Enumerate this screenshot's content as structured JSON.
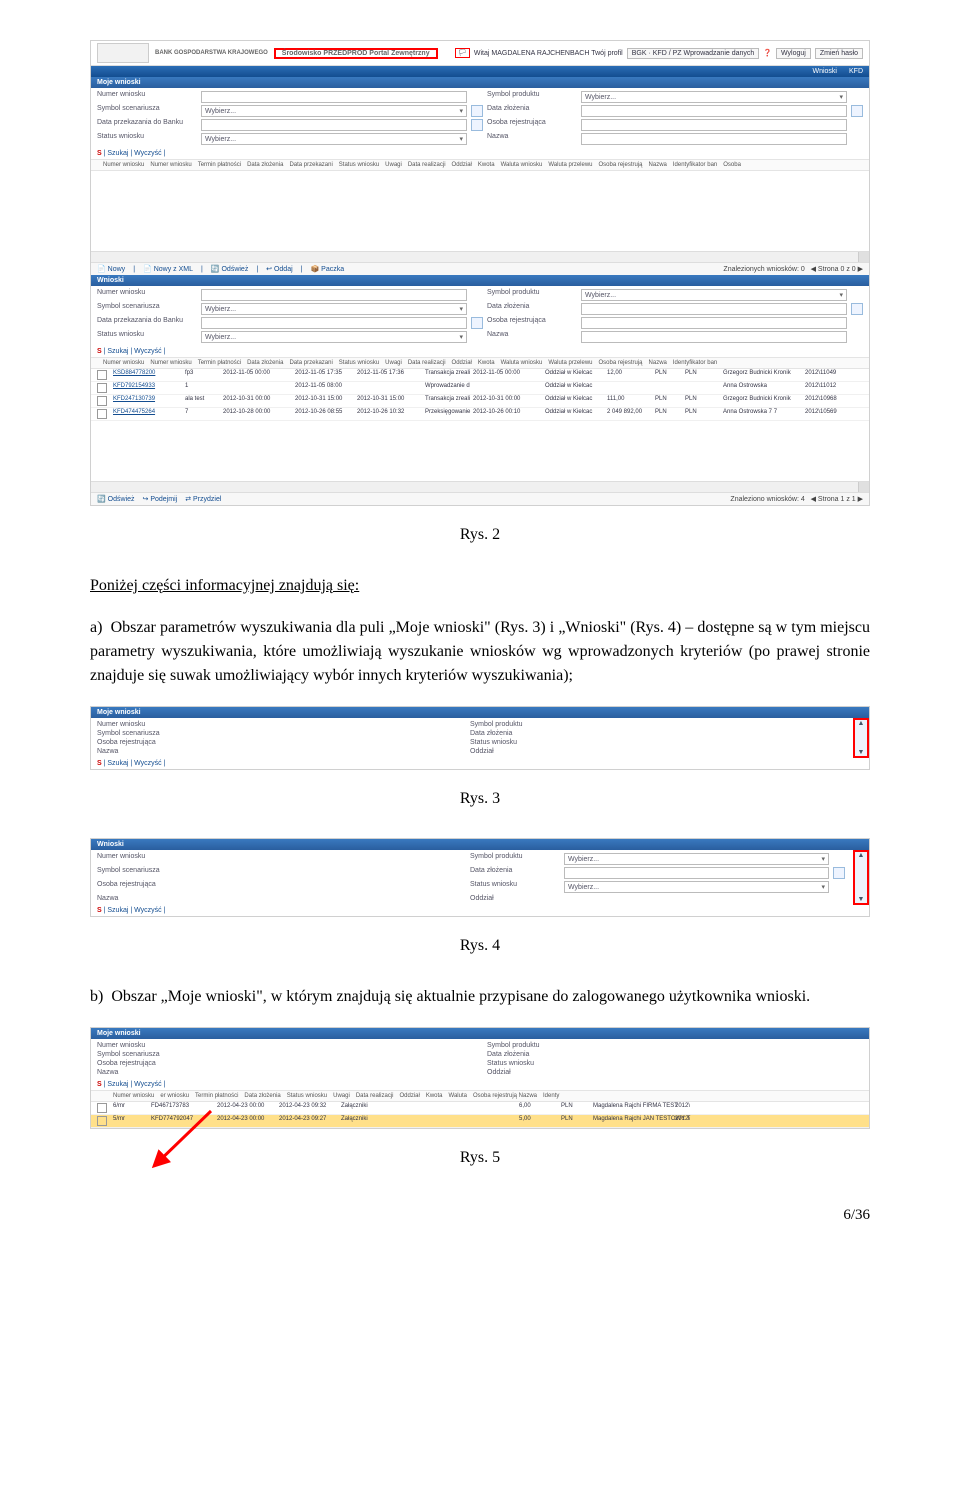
{
  "captions": {
    "r2": "Rys. 2",
    "r3": "Rys. 3",
    "r4": "Rys. 4",
    "r5": "Rys. 5"
  },
  "prose": {
    "intro": "Poniżej części informacyjnej znajdują się:",
    "a_lead": "a)",
    "a_body": "Obszar parametrów wyszukiwania dla puli „Moje wnioski\" (Rys. 3) i „Wnioski\" (Rys. 4) – dostępne są w tym miejscu parametry wyszukiwania, które umożliwiają wyszukanie wniosków wg wprowadzonych kryteriów (po prawej stronie znajduje się suwak umożliwiający wybór innych kryteriów wyszukiwania);",
    "b_lead": "b)",
    "b_body": "Obszar „Moje wnioski\", w którym znajdują się aktualnie przypisane do zalogowanego użytkownika wnioski."
  },
  "header": {
    "bank": "BANK GOSPODARSTWA KRAJOWEGO",
    "env": "Środowisko PRZEDPROD Portal Zewnętrzny",
    "welcome": "Witaj MAGDALENA RAJCHENBACH Twój profil",
    "profile": "BGK · KFD / PZ Wprowadzanie danych",
    "logout": "Wyloguj",
    "changepw": "Zmień hasło",
    "nav": {
      "wnioski": "Wnioski",
      "kfd": "KFD"
    }
  },
  "panel": {
    "moje": "Moje wnioski",
    "wnioski": "Wnioski",
    "labels": {
      "numer": "Numer wniosku",
      "symscen": "Symbol scenariusza",
      "dataprzek": "Data przekazania do Banku",
      "status": "Status wniosku",
      "symprod": "Symbol produktu",
      "datazloz": "Data złożenia",
      "osobarej": "Osoba rejestrująca",
      "nazwa": "Nazwa",
      "oddzial": "Oddział"
    },
    "wybierz": "Wybierz..."
  },
  "search": {
    "s": "S",
    "szukaj": "Szukaj",
    "wyczysc": "Wyczyść"
  },
  "cols": [
    "Numer wniosku",
    "Numer wniosku",
    "Termin płatności",
    "Data złożenia",
    "Data przekazani",
    "Status wniosku",
    "Uwagi",
    "Data realizacji",
    "Oddział",
    "Kwota",
    "Waluta wniosku",
    "Waluta przelewu",
    "Osoba rejestrują",
    "Nazwa",
    "Identyfikator ban",
    "Osoba"
  ],
  "toolbar": {
    "nowy": "Nowy",
    "nowyxml": "Nowy z XML",
    "odswiez": "Odśwież",
    "oddaj": "Oddaj",
    "paczka": "Paczka",
    "podejmij": "Podejmij",
    "przydziel": "Przydziel"
  },
  "footer1": {
    "found": "Znalezionych wniosków: 0",
    "pag": "Strona 0 z 0"
  },
  "footer2": {
    "found": "Znaleziono wniosków: 4",
    "pag": "Strona 1 z 1"
  },
  "rows": [
    {
      "nr": "KSD884778200",
      "nm": "fp3",
      "tp": "2012-11-05 00:00",
      "dz": "2012-11-05 17:35",
      "dp": "2012-11-05 17:36",
      "st": "Transakcja zreali",
      "dr": "2012-11-05 00:00",
      "od": "Oddział w Kielcac",
      "kw": "12,00",
      "ww": "PLN",
      "wp": "PLN",
      "os": "Grzegorz Budnicki Kronik",
      "id": "2012\\11049"
    },
    {
      "nr": "KFD792154933",
      "nm": "1",
      "tp": "",
      "dz": "2012-11-05 08:00",
      "dp": "",
      "st": "Wprowadzanie d",
      "dr": "",
      "od": "Oddział w Kielcac",
      "kw": "",
      "ww": "",
      "wp": "",
      "os": "Anna Ostrowska",
      "id": "2012\\11012"
    },
    {
      "nr": "KFD247130739",
      "nm": "ala test",
      "tp": "2012-10-31 00:00",
      "dz": "2012-10-31 15:00",
      "dp": "2012-10-31 15:00",
      "st": "Transakcja zreali",
      "dr": "2012-10-31 00:00",
      "od": "Oddział w Kielcac",
      "kw": "111,00",
      "ww": "PLN",
      "wp": "PLN",
      "os": "Grzegorz Budnicki Kronik",
      "id": "2012\\10968"
    },
    {
      "nr": "KFD474475264",
      "nm": "7",
      "tp": "2012-10-28 00:00",
      "dz": "2012-10-26 08:55",
      "dp": "2012-10-26 10:32",
      "st": "Przeksięgowanie",
      "dr": "2012-10-26 00:10",
      "od": "Oddział w Kielcac",
      "kw": "2 049 892,00",
      "ww": "PLN",
      "wp": "PLN",
      "os": "Anna Ostrowska 7 7",
      "id": "2012\\10569"
    }
  ],
  "s4": {
    "cols": [
      "",
      "Numer wniosku",
      "er wniosku",
      "Termin płatności",
      "Data złożenia",
      "Status wniosku",
      "Uwagi",
      "Data realizacji",
      "Oddział",
      "Kwota",
      "Waluta",
      "Osoba rejestrują Nazwa",
      "Identy"
    ],
    "rows": [
      {
        "a": "6/mr",
        "nr": "FD467173783",
        "tp": "2012-04-23 00:00",
        "dz": "2012-04-23 09:32",
        "st": "Załączniki",
        "kw": "6,00",
        "wa": "PLN",
        "os": "Magdalena Rajchi FIRMA TEST",
        "id": "2012\\"
      },
      {
        "a": "5/mr",
        "nr": "KFD774792047",
        "tp": "2012-04-23 00:00",
        "dz": "2012-04-23 09:27",
        "st": "Załączniki",
        "kw": "5,00",
        "wa": "PLN",
        "os": "Magdalena Rajchi JAN TESTOWY T",
        "id": "2012\\"
      }
    ]
  },
  "pageno": "6/36"
}
